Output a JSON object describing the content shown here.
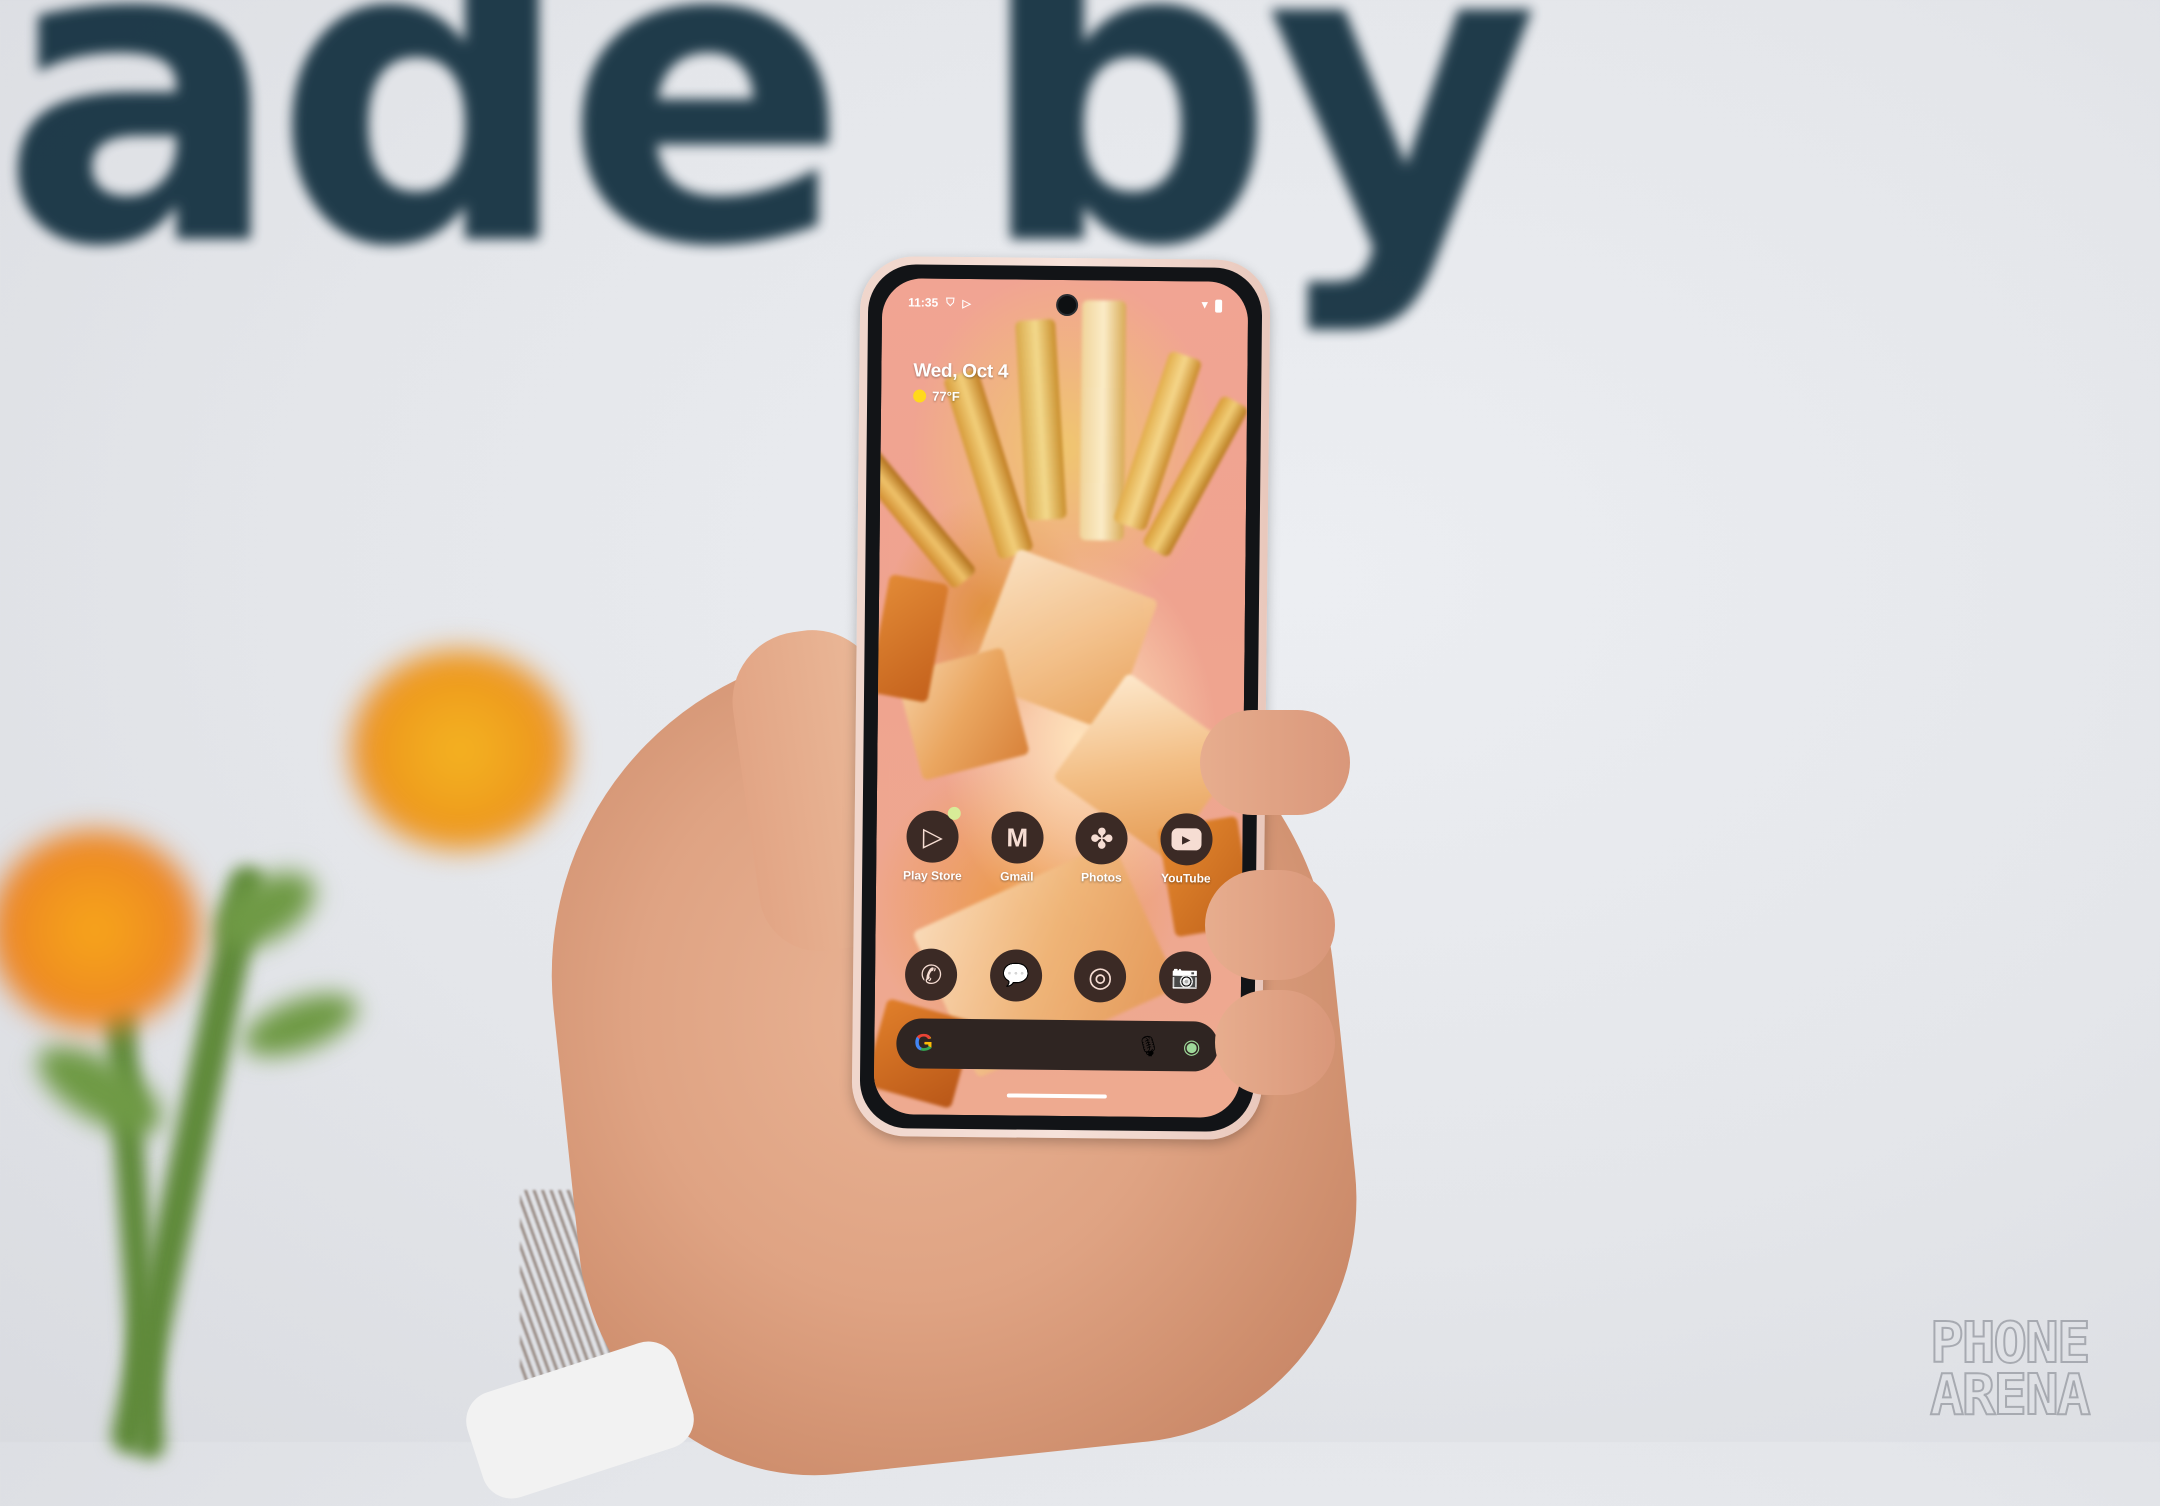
{
  "background": {
    "sign_text": "ade by",
    "sign_color": "#13536a"
  },
  "phone": {
    "status_bar": {
      "time": "11:35",
      "left_icons": [
        "vpn-shield-icon",
        "play-icon"
      ],
      "right_icons": [
        "wifi-icon",
        "battery-icon"
      ]
    },
    "at_a_glance": {
      "date": "Wed, Oct 4",
      "weather_icon": "sun-icon",
      "temperature": "77°F"
    },
    "apps_row_1": [
      {
        "label": "Play Store",
        "icon": "play-store-icon",
        "glyph": "▷",
        "notification_dot": true
      },
      {
        "label": "Gmail",
        "icon": "gmail-icon",
        "glyph": "M"
      },
      {
        "label": "Photos",
        "icon": "photos-pinwheel-icon",
        "glyph": "✤"
      },
      {
        "label": "YouTube",
        "icon": "youtube-icon",
        "glyph": "▶"
      }
    ],
    "dock": [
      {
        "label": "Phone",
        "icon": "phone-icon",
        "glyph": "✆"
      },
      {
        "label": "Messages",
        "icon": "messages-icon",
        "glyph": "💬"
      },
      {
        "label": "Chrome",
        "icon": "chrome-icon",
        "glyph": "◎"
      },
      {
        "label": "Camera",
        "icon": "camera-icon",
        "glyph": "📷"
      }
    ],
    "search_bar": {
      "google_logo": "G",
      "mic_icon": "🎙",
      "lens_icon": "◉"
    },
    "theme": {
      "icon_bg": "#3b2a25",
      "icon_fg": "#f6ddd3",
      "wallpaper_base": "#f1a493"
    }
  },
  "watermark": {
    "line1": "PHONE",
    "line2": "ARENA"
  }
}
